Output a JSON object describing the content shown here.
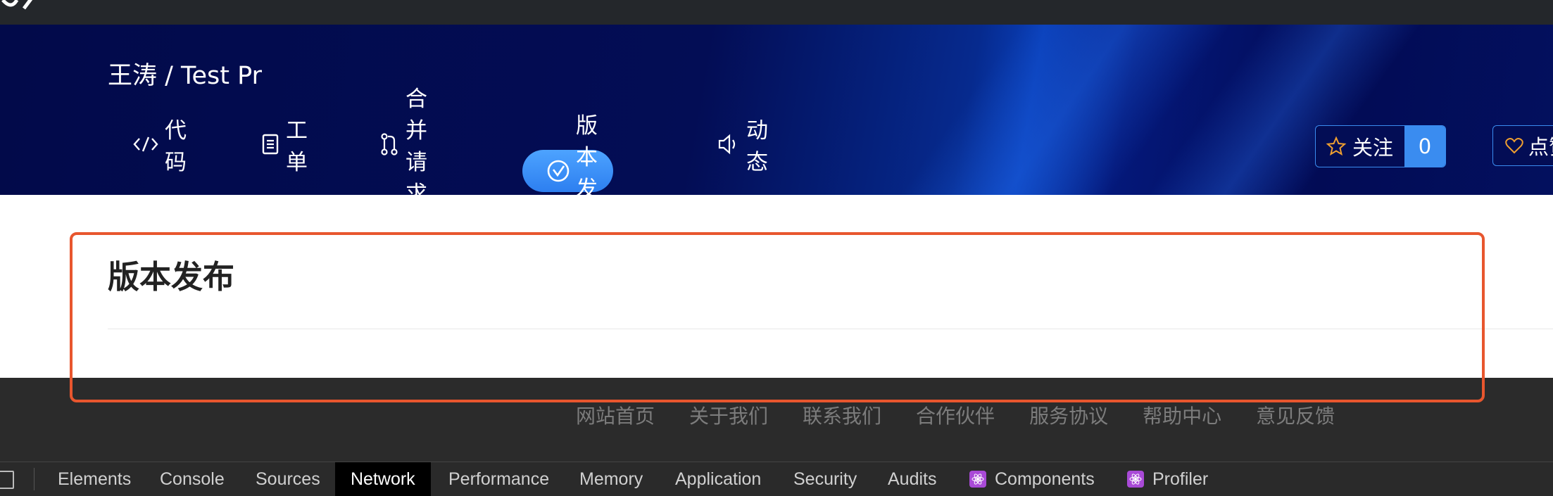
{
  "header": {
    "breadcrumb": "王涛 / Test Pr"
  },
  "nav": {
    "items": [
      {
        "label": "代码",
        "icon": "code-icon"
      },
      {
        "label": "工单",
        "icon": "clipboard-icon"
      },
      {
        "label": "合并请求",
        "icon": "merge-request-icon"
      },
      {
        "label": "版本发布",
        "icon": "release-check-icon",
        "active": true
      },
      {
        "label": "动态",
        "icon": "speaker-icon"
      }
    ]
  },
  "actions": {
    "follow_label": "关注",
    "follow_count": "0",
    "like_label": "点赞"
  },
  "main": {
    "title": "版本发布"
  },
  "footer": {
    "links": [
      "网站首页",
      "关于我们",
      "联系我们",
      "合作伙伴",
      "服务协议",
      "帮助中心",
      "意见反馈"
    ]
  },
  "devtools": {
    "tabs": [
      "Elements",
      "Console",
      "Sources",
      "Network",
      "Performance",
      "Memory",
      "Application",
      "Security",
      "Audits",
      "Components",
      "Profiler"
    ],
    "active_tab": "Network"
  },
  "colors": {
    "accent": "#3a8cf0",
    "highlight_border": "#e8562e",
    "hero_bg": "#030d55"
  }
}
